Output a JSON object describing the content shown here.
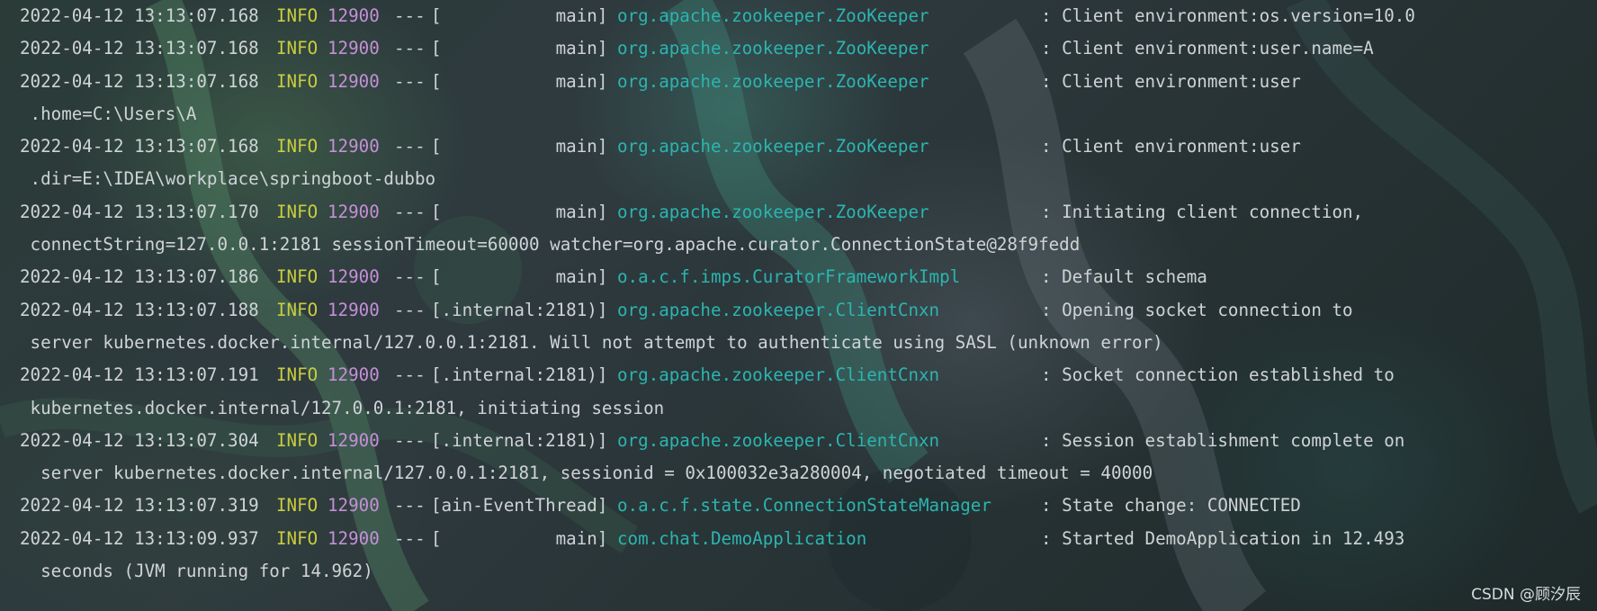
{
  "console": {
    "lines": [
      {
        "timestamp": "2022-04-12 13:13:07.168",
        "level": "INFO",
        "pid": "12900",
        "sep": "---",
        "thread": "[           main]",
        "logger": "org.apache.zookeeper.ZooKeeper",
        "message": ": Client environment:os.version=10.0"
      },
      {
        "timestamp": "2022-04-12 13:13:07.168",
        "level": "INFO",
        "pid": "12900",
        "sep": "---",
        "thread": "[           main]",
        "logger": "org.apache.zookeeper.ZooKeeper",
        "message": ": Client environment:user.name=A"
      },
      {
        "timestamp": "2022-04-12 13:13:07.168",
        "level": "INFO",
        "pid": "12900",
        "sep": "---",
        "thread": "[           main]",
        "logger": "org.apache.zookeeper.ZooKeeper",
        "message": ": Client environment:user"
      },
      {
        "continuation": " .home=C:\\Users\\A"
      },
      {
        "timestamp": "2022-04-12 13:13:07.168",
        "level": "INFO",
        "pid": "12900",
        "sep": "---",
        "thread": "[           main]",
        "logger": "org.apache.zookeeper.ZooKeeper",
        "message": ": Client environment:user"
      },
      {
        "continuation": " .dir=E:\\IDEA\\workplace\\springboot-dubbo"
      },
      {
        "timestamp": "2022-04-12 13:13:07.170",
        "level": "INFO",
        "pid": "12900",
        "sep": "---",
        "thread": "[           main]",
        "logger": "org.apache.zookeeper.ZooKeeper",
        "message": ": Initiating client connection,"
      },
      {
        "continuation": " connectString=127.0.0.1:2181 sessionTimeout=60000 watcher=org.apache.curator.ConnectionState@28f9fedd"
      },
      {
        "timestamp": "2022-04-12 13:13:07.186",
        "level": "INFO",
        "pid": "12900",
        "sep": "---",
        "thread": "[           main]",
        "logger": "o.a.c.f.imps.CuratorFrameworkImpl",
        "message": ": Default schema"
      },
      {
        "timestamp": "2022-04-12 13:13:07.188",
        "level": "INFO",
        "pid": "12900",
        "sep": "---",
        "thread": "[.internal:2181)]",
        "logger": "org.apache.zookeeper.ClientCnxn",
        "message": ": Opening socket connection to"
      },
      {
        "continuation": " server kubernetes.docker.internal/127.0.0.1:2181. Will not attempt to authenticate using SASL (unknown error)"
      },
      {
        "timestamp": "2022-04-12 13:13:07.191",
        "level": "INFO",
        "pid": "12900",
        "sep": "---",
        "thread": "[.internal:2181)]",
        "logger": "org.apache.zookeeper.ClientCnxn",
        "message": ": Socket connection established to"
      },
      {
        "continuation": " kubernetes.docker.internal/127.0.0.1:2181, initiating session"
      },
      {
        "timestamp": "2022-04-12 13:13:07.304",
        "level": "INFO",
        "pid": "12900",
        "sep": "---",
        "thread": "[.internal:2181)]",
        "logger": "org.apache.zookeeper.ClientCnxn",
        "message": ": Session establishment complete on"
      },
      {
        "continuation": "  server kubernetes.docker.internal/127.0.0.1:2181, sessionid = 0x100032e3a280004, negotiated timeout = 40000"
      },
      {
        "timestamp": "2022-04-12 13:13:07.319",
        "level": "INFO",
        "pid": "12900",
        "sep": "---",
        "thread": "[ain-EventThread]",
        "logger": "o.a.c.f.state.ConnectionStateManager",
        "message": ": State change: CONNECTED"
      },
      {
        "timestamp": "2022-04-12 13:13:09.937",
        "level": "INFO",
        "pid": "12900",
        "sep": "---",
        "thread": "[           main]",
        "logger": "com.chat.DemoApplication",
        "message": ": Started DemoApplication in 12.493"
      },
      {
        "continuation": "  seconds (JVM running for 14.962)"
      }
    ]
  },
  "watermark": "CSDN @顾汐辰",
  "colors": {
    "level": "#c9cc3f",
    "pid": "#c58fd8",
    "logger": "#2bb5b0",
    "text": "#cfd3d6"
  }
}
